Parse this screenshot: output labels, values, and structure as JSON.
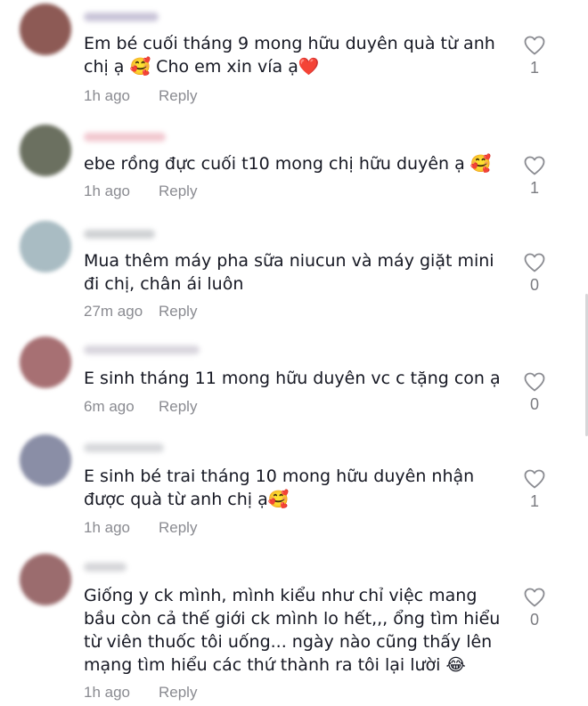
{
  "comments": [
    {
      "text": "Em bé cuối tháng 9 mong hữu duyên quà từ anh chị ạ 🥰 Cho em xin vía ạ❤️",
      "time": "1h ago",
      "reply_label": "Reply",
      "likes": "1",
      "avatar_color": "#8d5a55",
      "name_color": "#9c93b8"
    },
    {
      "text": "ebe rồng đực cuối t10 mong chị hữu duyên ạ 🥰",
      "time": "1h ago",
      "reply_label": "Reply",
      "likes": "1",
      "avatar_color": "#6b7060",
      "name_color": "#e79aa8"
    },
    {
      "text": "Mua thêm máy pha sữa niucun và máy giặt mini đi chị, chân ái luôn",
      "time": "27m ago",
      "reply_label": "Reply",
      "likes": "0",
      "avatar_color": "#a9bcc3",
      "name_color": "#a7abb0"
    },
    {
      "text": "E sinh tháng 11 mong hữu duyên vc c tặng con ạ",
      "time": "6m ago",
      "reply_label": "Reply",
      "likes": "0",
      "avatar_color": "#a77073",
      "name_color": "#b9b3c2"
    },
    {
      "text": "E sinh bé trai tháng 10 mong hữu duyên nhận được quà từ anh chị ạ🥰",
      "time": "1h ago",
      "reply_label": "Reply",
      "likes": "1",
      "avatar_color": "#8a8ea6",
      "name_color": "#b6b8be"
    },
    {
      "text": "Giống y ck mình, mình kiểu như chỉ việc mang bầu còn cả thế giới ck mình lo hết,,, ổng tìm hiểu từ viên thuốc tôi uống... ngày nào cũng thấy lên mạng tìm hiểu các thứ thành ra tôi lại lười 😂",
      "time": "1h ago",
      "reply_label": "Reply",
      "likes": "0",
      "avatar_color": "#9b6c6e",
      "name_color": "#b3b4ba"
    }
  ]
}
